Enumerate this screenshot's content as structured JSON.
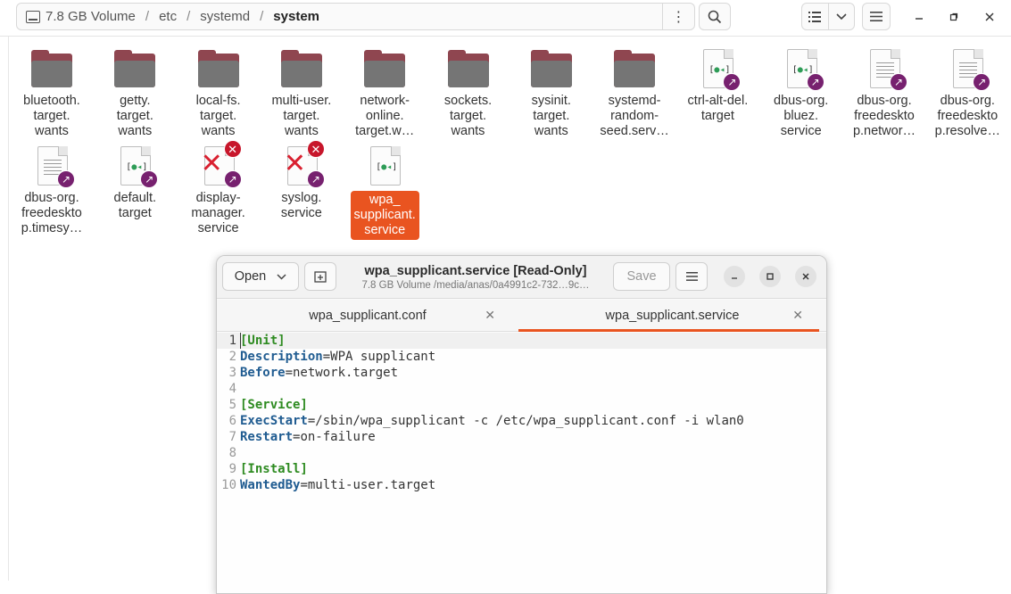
{
  "file_manager": {
    "path": [
      "7.8 GB Volume",
      "etc",
      "systemd",
      "system"
    ],
    "icons": {
      "path_menu": "vertical-ellipsis-icon",
      "search": "search-icon",
      "list_view": "list-view-icon",
      "view_options": "chevron-down-icon",
      "main_menu": "hamburger-menu-icon",
      "minimize": "minimize-icon",
      "maximize": "maximize-icon",
      "close": "close-icon"
    },
    "files": [
      {
        "label": "bluetooth.\ntarget.\nwants",
        "kind": "folder"
      },
      {
        "label": "getty.\ntarget.\nwants",
        "kind": "folder"
      },
      {
        "label": "local-fs.\ntarget.\nwants",
        "kind": "folder"
      },
      {
        "label": "multi-user.\ntarget.\nwants",
        "kind": "folder"
      },
      {
        "label": "network-\nonline.\ntarget.w…",
        "kind": "folder"
      },
      {
        "label": "sockets.\ntarget.\nwants",
        "kind": "folder"
      },
      {
        "label": "sysinit.\ntarget.\nwants",
        "kind": "folder"
      },
      {
        "label": "systemd-\nrandom-\nseed.serv…",
        "kind": "folder"
      },
      {
        "label": "ctrl-alt-del.\ntarget",
        "kind": "unit-link"
      },
      {
        "label": "dbus-org.\nbluez.\nservice",
        "kind": "unit-link"
      },
      {
        "label": "dbus-org.\nfreedeskto\np.networ…",
        "kind": "text-link"
      },
      {
        "label": "dbus-org.\nfreedeskto\np.resolve…",
        "kind": "text-link"
      },
      {
        "label": "dbus-org.\nfreedeskto\np.timesy…",
        "kind": "text-link"
      },
      {
        "label": "default.\ntarget",
        "kind": "unit-link"
      },
      {
        "label": "display-\nmanager.\nservice",
        "kind": "broken-link"
      },
      {
        "label": "syslog.\nservice",
        "kind": "broken-link"
      },
      {
        "label": "wpa_\nsupplicant.\nservice",
        "kind": "unit",
        "selected": true
      }
    ],
    "accent_color": "#e95420",
    "folder_color": "#8f4650",
    "link_badge_color": "#77216f"
  },
  "editor": {
    "open_label": "Open",
    "title": "wpa_supplicant.service [Read-Only]",
    "subtitle": "7.8 GB Volume /media/anas/0a4991c2-732…9c…",
    "save_label": "Save",
    "tabs": [
      {
        "label": "wpa_supplicant.conf",
        "active": false
      },
      {
        "label": "wpa_supplicant.service",
        "active": true
      }
    ],
    "lines": [
      {
        "n": "1",
        "parts": [
          {
            "t": "[Unit]",
            "c": "section"
          }
        ]
      },
      {
        "n": "2",
        "parts": [
          {
            "t": "Description",
            "c": "key"
          },
          {
            "t": "=WPA supplicant",
            "c": ""
          }
        ]
      },
      {
        "n": "3",
        "parts": [
          {
            "t": "Before",
            "c": "key"
          },
          {
            "t": "=network.target",
            "c": ""
          }
        ]
      },
      {
        "n": "4",
        "parts": []
      },
      {
        "n": "5",
        "parts": [
          {
            "t": "[Service]",
            "c": "section"
          }
        ]
      },
      {
        "n": "6",
        "parts": [
          {
            "t": "ExecStart",
            "c": "key"
          },
          {
            "t": "=/sbin/wpa_supplicant -c /etc/wpa_supplicant.conf -i wlan0",
            "c": ""
          }
        ]
      },
      {
        "n": "7",
        "parts": [
          {
            "t": "Restart",
            "c": "key"
          },
          {
            "t": "=on-failure",
            "c": ""
          }
        ]
      },
      {
        "n": "8",
        "parts": []
      },
      {
        "n": "9",
        "parts": [
          {
            "t": "[Install]",
            "c": "section"
          }
        ]
      },
      {
        "n": "10",
        "parts": [
          {
            "t": "WantedBy",
            "c": "key"
          },
          {
            "t": "=multi-user.target",
            "c": ""
          }
        ]
      }
    ]
  }
}
